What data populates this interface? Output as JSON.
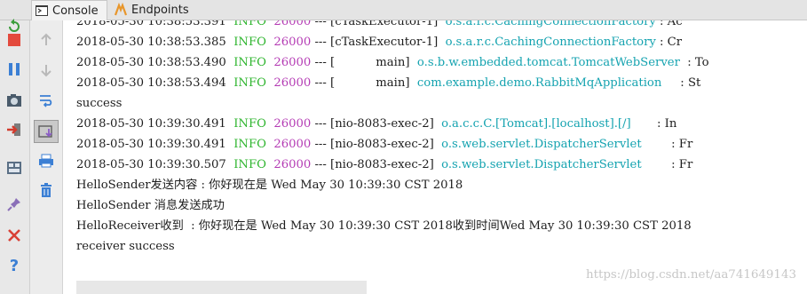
{
  "tabs": [
    {
      "label": "Console",
      "active": true,
      "icon": "console-icon"
    },
    {
      "label": "Endpoints",
      "active": false,
      "icon": "endpoints-icon"
    }
  ],
  "colors": {
    "info": "#2fb52f",
    "pid": "#b43bb4",
    "logger": "#15a3b0"
  },
  "left_toolbar": [
    "rerun-icon",
    "stop-icon",
    "pause-icon",
    "camera-icon",
    "login-icon",
    "layout-icon",
    "pin-icon",
    "close-icon",
    "help-icon"
  ],
  "inner_toolbar": [
    "up-arrow-icon",
    "down-arrow-icon",
    "soft-wrap-icon",
    "scroll-to-end-icon",
    "print-icon",
    "trash-icon"
  ],
  "log": [
    {
      "ts": "2018-05-30 10:38:53.391",
      "level": "INFO",
      "pid": "26000",
      "thread": "[cTaskExecutor-1]",
      "logger": "o.s.a.r.c.CachingConnectionFactory",
      "rest": " : Ac"
    },
    {
      "ts": "2018-05-30 10:38:53.385",
      "level": "INFO",
      "pid": "26000",
      "thread": "[cTaskExecutor-1]",
      "logger": "o.s.a.r.c.CachingConnectionFactory",
      "rest": " : Cr"
    },
    {
      "ts": "2018-05-30 10:38:53.490",
      "level": "INFO",
      "pid": "26000",
      "thread": "[           main]",
      "logger": "o.s.b.w.embedded.tomcat.TomcatWebServer",
      "rest": "  : To"
    },
    {
      "ts": "2018-05-30 10:38:53.494",
      "level": "INFO",
      "pid": "26000",
      "thread": "[           main]",
      "logger": "com.example.demo.RabbitMqApplication",
      "rest": "     : St"
    },
    {
      "text": "success"
    },
    {
      "ts": "2018-05-30 10:39:30.491",
      "level": "INFO",
      "pid": "26000",
      "thread": "[nio-8083-exec-2]",
      "logger": "o.a.c.c.C.[Tomcat].[localhost].[/]",
      "rest": "       : In"
    },
    {
      "ts": "2018-05-30 10:39:30.491",
      "level": "INFO",
      "pid": "26000",
      "thread": "[nio-8083-exec-2]",
      "logger": "o.s.web.servlet.DispatcherServlet",
      "rest": "        : Fr"
    },
    {
      "ts": "2018-05-30 10:39:30.507",
      "level": "INFO",
      "pid": "26000",
      "thread": "[nio-8083-exec-2]",
      "logger": "o.s.web.servlet.DispatcherServlet",
      "rest": "        : Fr"
    },
    {
      "text": "HelloSender发送内容 : 你好现在是 Wed May 30 10:39:30 CST 2018"
    },
    {
      "text": "HelloSender 消息发送成功"
    },
    {
      "text": "HelloReceiver收到  : 你好现在是 Wed May 30 10:39:30 CST 2018收到时间Wed May 30 10:39:30 CST 2018"
    },
    {
      "text": "receiver success"
    }
  ],
  "watermark": "https://blog.csdn.net/aa741649143"
}
